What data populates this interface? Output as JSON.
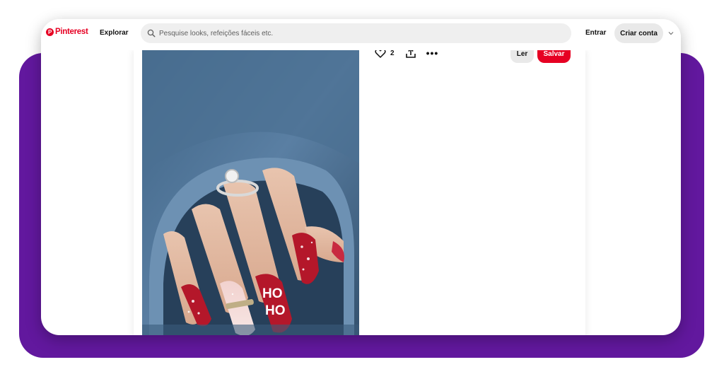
{
  "header": {
    "logo_text": "Pinterest",
    "explore_label": "Explorar",
    "search_placeholder": "Pesquise looks, refeições fáceis etc.",
    "login_label": "Entrar",
    "signup_label": "Criar conta"
  },
  "pin": {
    "like_count": "2",
    "more_label": "•••",
    "read_label": "Ler",
    "save_label": "Salvar",
    "nail_text_1": "HO",
    "nail_text_2": "HO"
  },
  "colors": {
    "frame": "#62189e",
    "brand": "#e60023",
    "search_bg": "#efefef",
    "button_gray": "#e9e9e9"
  },
  "icons": [
    "pinterest-logo-icon",
    "search-icon",
    "chevron-down-icon",
    "heart-icon",
    "share-icon",
    "more-icon"
  ]
}
